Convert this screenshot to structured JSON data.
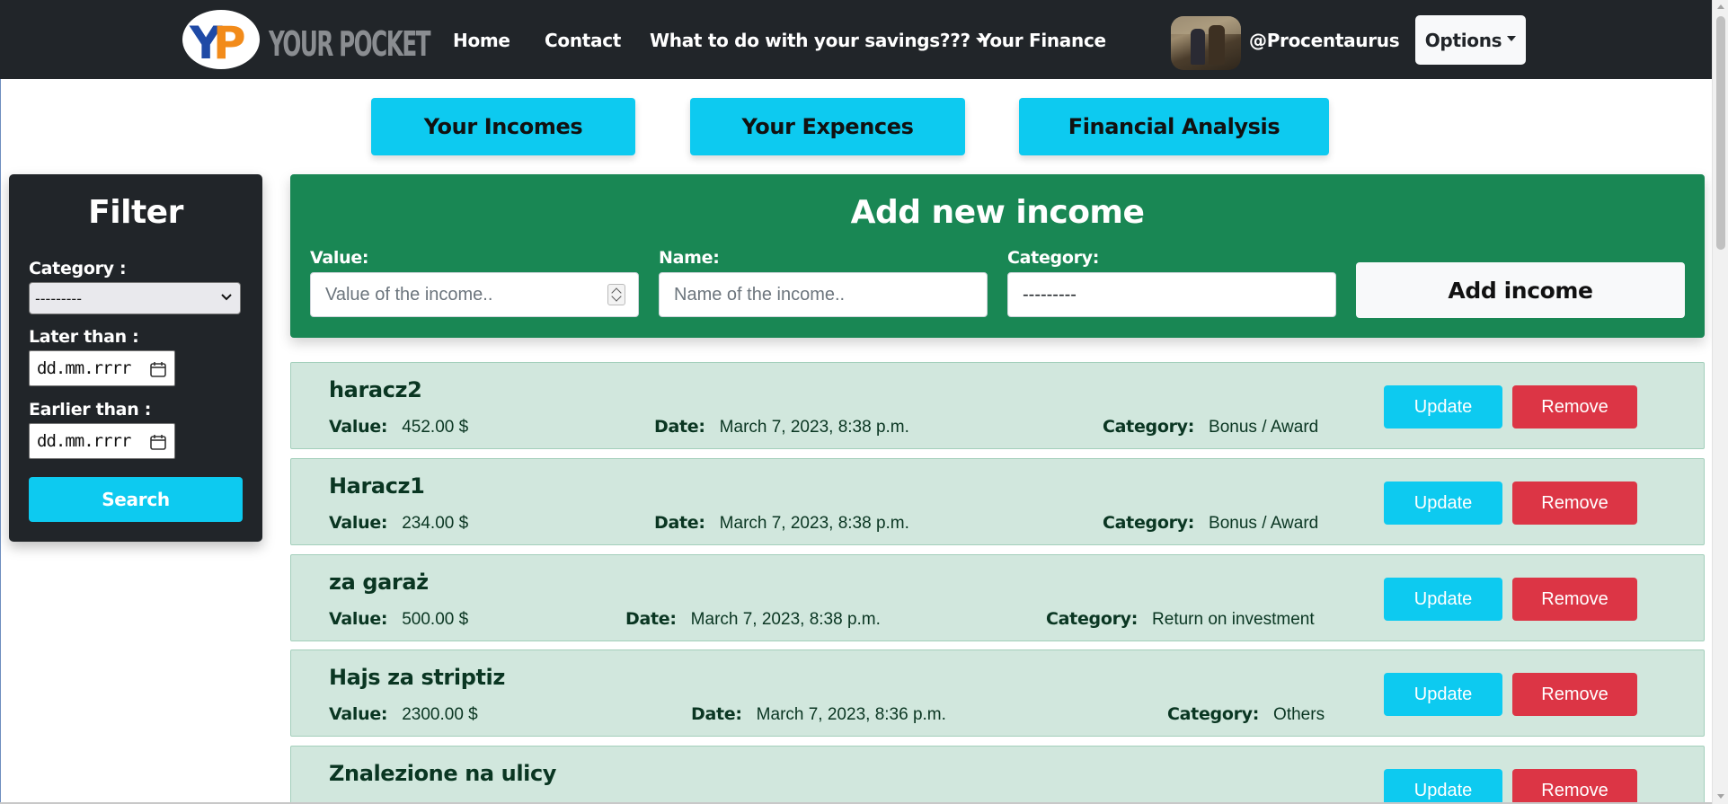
{
  "navbar": {
    "logo_text": "YOUR POCKET",
    "links": {
      "home": "Home",
      "contact": "Contact",
      "savings": "What to do with your savings???",
      "finance": "Your Finance"
    },
    "username": "@Procentaurus",
    "options_label": "Options"
  },
  "sections": {
    "incomes": "Your Incomes",
    "expences": "Your Expences",
    "analysis": "Financial Analysis"
  },
  "filter": {
    "title": "Filter",
    "category_label": "Category :",
    "category_value": "---------",
    "later_label": "Later than :",
    "later_value": "dd.mm.rrrr",
    "earlier_label": "Earlier than :",
    "earlier_value": "dd.mm.rrrr",
    "search_label": "Search"
  },
  "add_income": {
    "title": "Add new income",
    "value_label": "Value:",
    "value_placeholder": "Value of the income..",
    "name_label": "Name:",
    "name_placeholder": "Name of the income..",
    "category_label": "Category:",
    "category_value": "---------",
    "button_label": "Add income"
  },
  "incomes": {
    "field_labels": {
      "value": "Value:",
      "date": "Date:",
      "category": "Category:"
    },
    "update_label": "Update",
    "remove_label": "Remove",
    "items": [
      {
        "name": "haracz2",
        "value": "452.00 $",
        "date": "March 7, 2023, 8:38 p.m.",
        "category": "Bonus / Award"
      },
      {
        "name": "Haracz1",
        "value": "234.00 $",
        "date": "March 7, 2023, 8:38 p.m.",
        "category": "Bonus / Award"
      },
      {
        "name": "za garaż",
        "value": "500.00 $",
        "date": "March 7, 2023, 8:38 p.m.",
        "category": "Return on investment"
      },
      {
        "name": "Hajs za striptiz",
        "value": "2300.00 $",
        "date": "March 7, 2023, 8:36 p.m.",
        "category": "Others"
      },
      {
        "name": "Znalezione na ulicy",
        "value": "",
        "date": "",
        "category": ""
      }
    ]
  },
  "colors": {
    "navbar_bg": "#212529",
    "accent_info": "#0dcaf0",
    "success": "#198754",
    "danger": "#dc3545",
    "row_bg": "#d1e7dd"
  }
}
